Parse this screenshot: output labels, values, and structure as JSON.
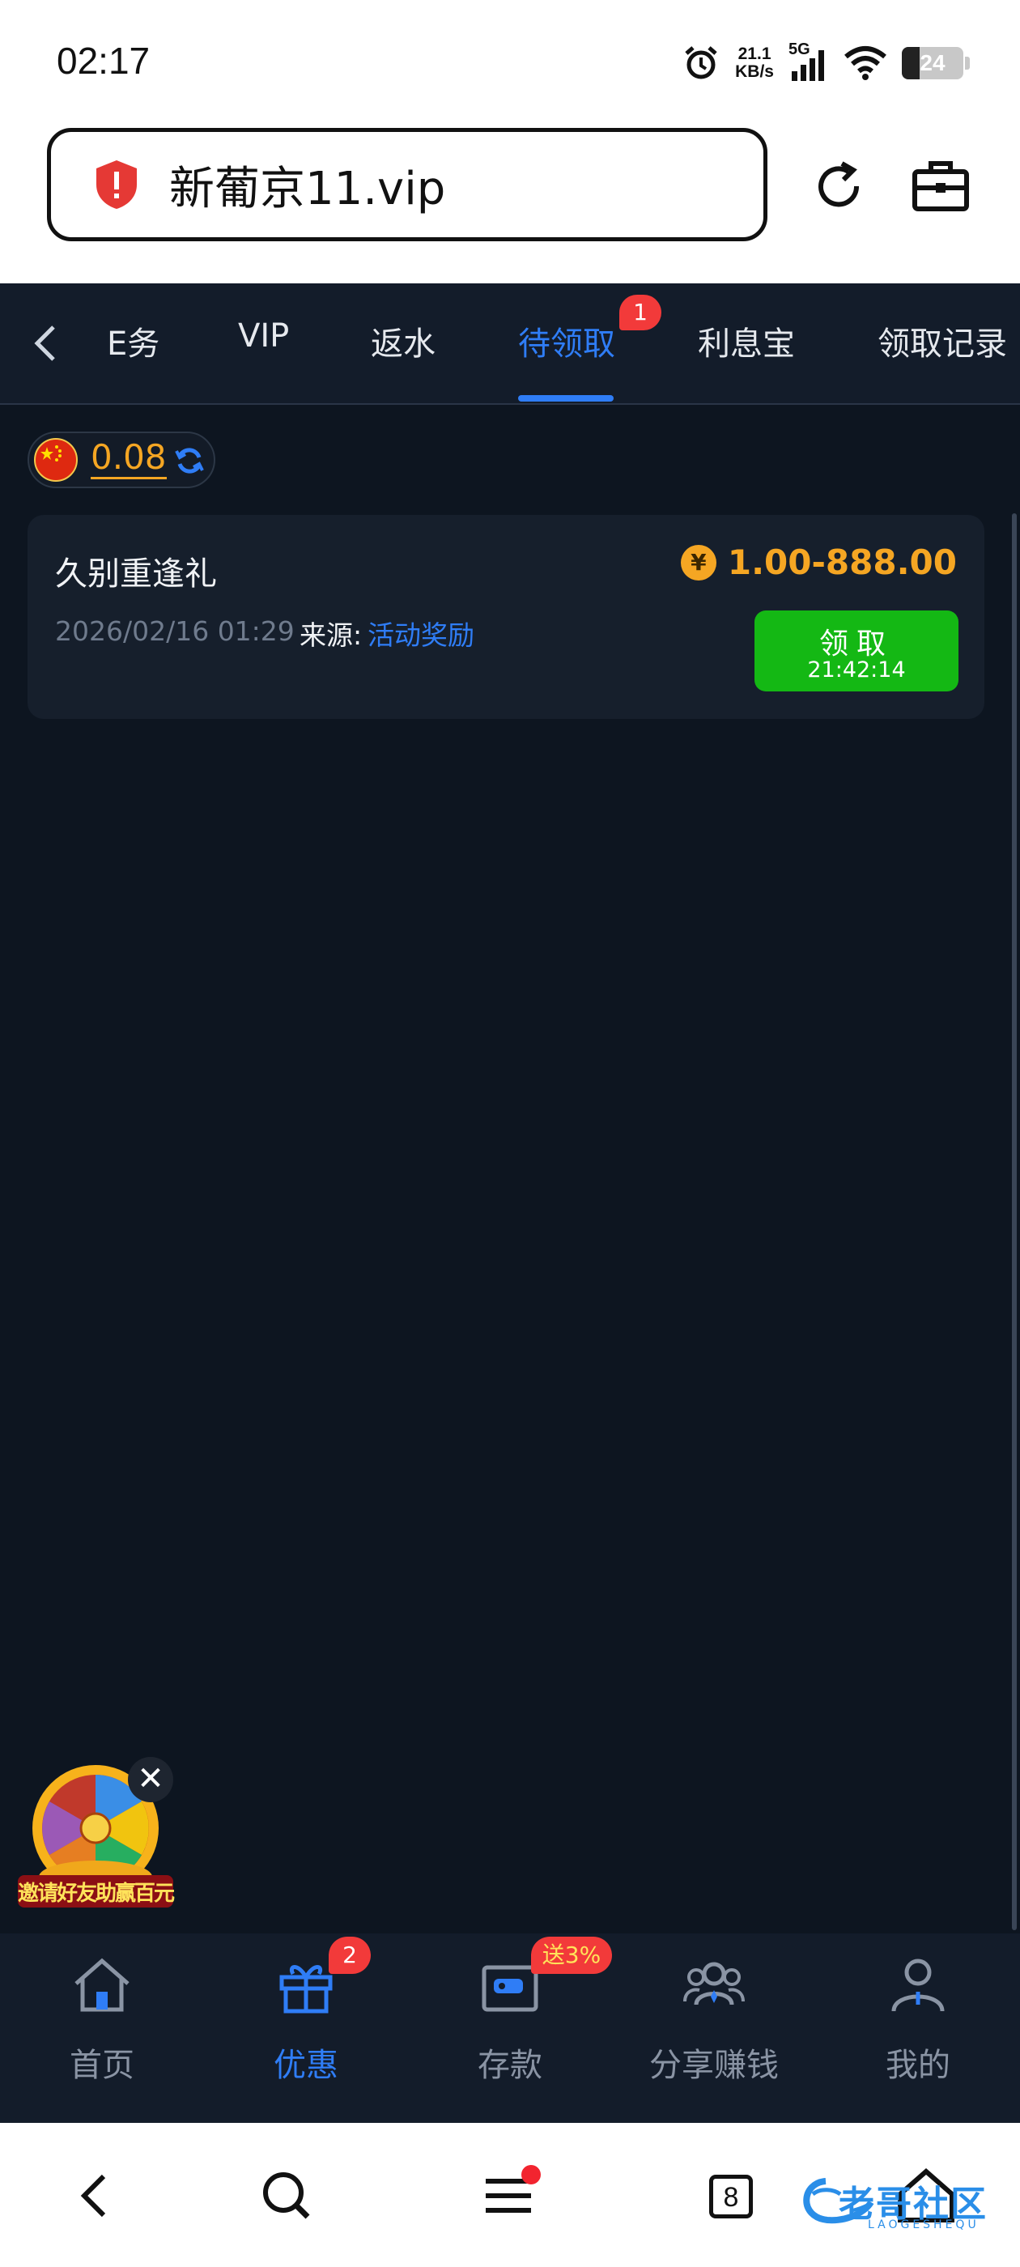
{
  "status_bar": {
    "time": "02:17",
    "net_speed_value": "21.1",
    "net_speed_unit": "KB/s",
    "signal_label": "5G",
    "battery": "24"
  },
  "browser": {
    "url": "新葡京11.vip"
  },
  "top_nav": {
    "tabs": [
      {
        "label": "任务",
        "visible_text": "E务"
      },
      {
        "label": "VIP"
      },
      {
        "label": "返水"
      },
      {
        "label": "待领取",
        "active": true,
        "badge": "1"
      },
      {
        "label": "利息宝"
      },
      {
        "label": "领取记录"
      }
    ]
  },
  "balance": {
    "currency_flag": "CN",
    "value": "0.08"
  },
  "rewards": [
    {
      "title": "久别重逢礼",
      "amount": "1.00-888.00",
      "coin_symbol": "¥",
      "date": "2026/02/16 01:29",
      "source_label": "来源:",
      "source_value": "活动奖励",
      "claim_label": "领取",
      "countdown": "21:42:14"
    }
  ],
  "promo": {
    "caption": "邀请好友助赢百元",
    "close_symbol": "✕"
  },
  "bottom_tabs": [
    {
      "label": "首页",
      "icon": "home-icon"
    },
    {
      "label": "优惠",
      "icon": "gift-icon",
      "active": true,
      "badge": "2"
    },
    {
      "label": "存款",
      "icon": "wallet-icon",
      "badge": "送3%"
    },
    {
      "label": "分享赚钱",
      "icon": "share-icon"
    },
    {
      "label": "我的",
      "icon": "user-icon"
    }
  ],
  "system_nav": {
    "tab_count": "8",
    "watermark_text": "老哥社区",
    "watermark_sub": "LAOGESHEQU"
  },
  "colors": {
    "background": "#0d1520",
    "accent_blue": "#2f7df6",
    "amount_orange": "#f5a623",
    "claim_green": "#14b814",
    "badge_red": "#f23a3a"
  }
}
